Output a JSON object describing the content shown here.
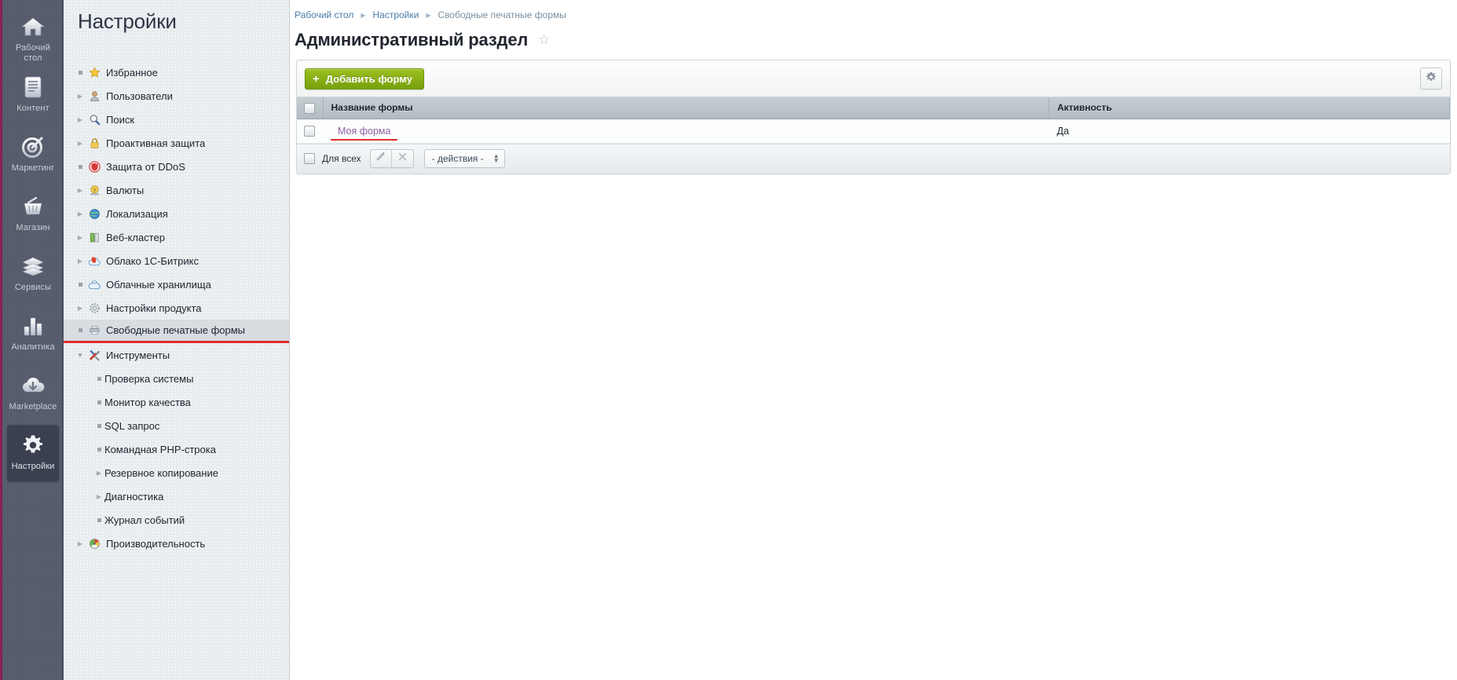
{
  "vertical_nav": {
    "items": [
      {
        "icon": "home-icon",
        "label": "Рабочий стол",
        "active": false
      },
      {
        "icon": "document-icon",
        "label": "Контент",
        "active": false
      },
      {
        "icon": "target-icon",
        "label": "Маркетинг",
        "active": false
      },
      {
        "icon": "basket-icon",
        "label": "Магазин",
        "active": false
      },
      {
        "icon": "layers-icon",
        "label": "Сервисы",
        "active": false
      },
      {
        "icon": "bar-chart-icon",
        "label": "Аналитика",
        "active": false
      },
      {
        "icon": "cloud-download-icon",
        "label": "Marketplace",
        "active": false
      },
      {
        "icon": "gear-icon",
        "label": "Настройки",
        "active": true
      }
    ]
  },
  "sidebar": {
    "title": "Настройки",
    "items": [
      {
        "label": "Избранное",
        "marker": "dot",
        "icon": "star-icon",
        "selected": false
      },
      {
        "label": "Пользователи",
        "marker": "right",
        "icon": "user-icon",
        "selected": false
      },
      {
        "label": "Поиск",
        "marker": "right",
        "icon": "search-icon",
        "selected": false
      },
      {
        "label": "Проактивная защита",
        "marker": "right",
        "icon": "lock-icon",
        "selected": false
      },
      {
        "label": "Защита от DDoS",
        "marker": "dot",
        "icon": "shield-icon",
        "selected": false
      },
      {
        "label": "Валюты",
        "marker": "right",
        "icon": "coin-icon",
        "selected": false
      },
      {
        "label": "Локализация",
        "marker": "right",
        "icon": "globe-icon",
        "selected": false
      },
      {
        "label": "Веб-кластер",
        "marker": "right",
        "icon": "server-icon",
        "selected": false
      },
      {
        "label": "Облако 1С-Битрикс",
        "marker": "right",
        "icon": "cloud-bx-icon",
        "selected": false
      },
      {
        "label": "Облачные хранилища",
        "marker": "dot",
        "icon": "cloud-icon",
        "selected": false
      },
      {
        "label": "Настройки продукта",
        "marker": "right",
        "icon": "cog-icon",
        "selected": false
      },
      {
        "label": "Свободные печатные формы",
        "marker": "dot",
        "icon": "printer-icon",
        "selected": true
      },
      {
        "label": "Инструменты",
        "marker": "down",
        "icon": "tools-icon",
        "selected": false
      }
    ],
    "tools_children": [
      {
        "label": "Проверка системы",
        "marker": "dot"
      },
      {
        "label": "Монитор качества",
        "marker": "dot"
      },
      {
        "label": "SQL запрос",
        "marker": "dot"
      },
      {
        "label": "Командная PHP-строка",
        "marker": "dot"
      },
      {
        "label": "Резервное копирование",
        "marker": "right"
      },
      {
        "label": "Диагностика",
        "marker": "right"
      },
      {
        "label": "Журнал событий",
        "marker": "dot"
      }
    ],
    "items_tail": [
      {
        "label": "Производительность",
        "marker": "right",
        "icon": "gauge-icon",
        "selected": false
      }
    ]
  },
  "breadcrumb": {
    "items": [
      "Рабочий стол",
      "Настройки"
    ],
    "current": "Свободные печатные формы",
    "separator": "▶"
  },
  "page": {
    "title": "Административный раздел",
    "favorite_icon": "star-outline-icon"
  },
  "toolbar": {
    "add_button_label": "Добавить форму",
    "add_button_plus": "+",
    "settings_icon": "gear-icon"
  },
  "table": {
    "columns": [
      "Название формы",
      "Активность"
    ],
    "rows": [
      {
        "name": "Моя форма",
        "active": "Да"
      }
    ]
  },
  "footer": {
    "select_all_label": "Для всех",
    "edit_icon": "pencil-icon",
    "delete_icon": "close-icon",
    "actions_select_value": "- действия -"
  },
  "colors": {
    "accent_green": "#88b117",
    "accent_red": "#e02d2d",
    "link_blue": "#4a7ca8",
    "visited_link": "#8e5fa0",
    "nav_bg": "#565b6b",
    "nav_accent": "#8c1f55"
  }
}
